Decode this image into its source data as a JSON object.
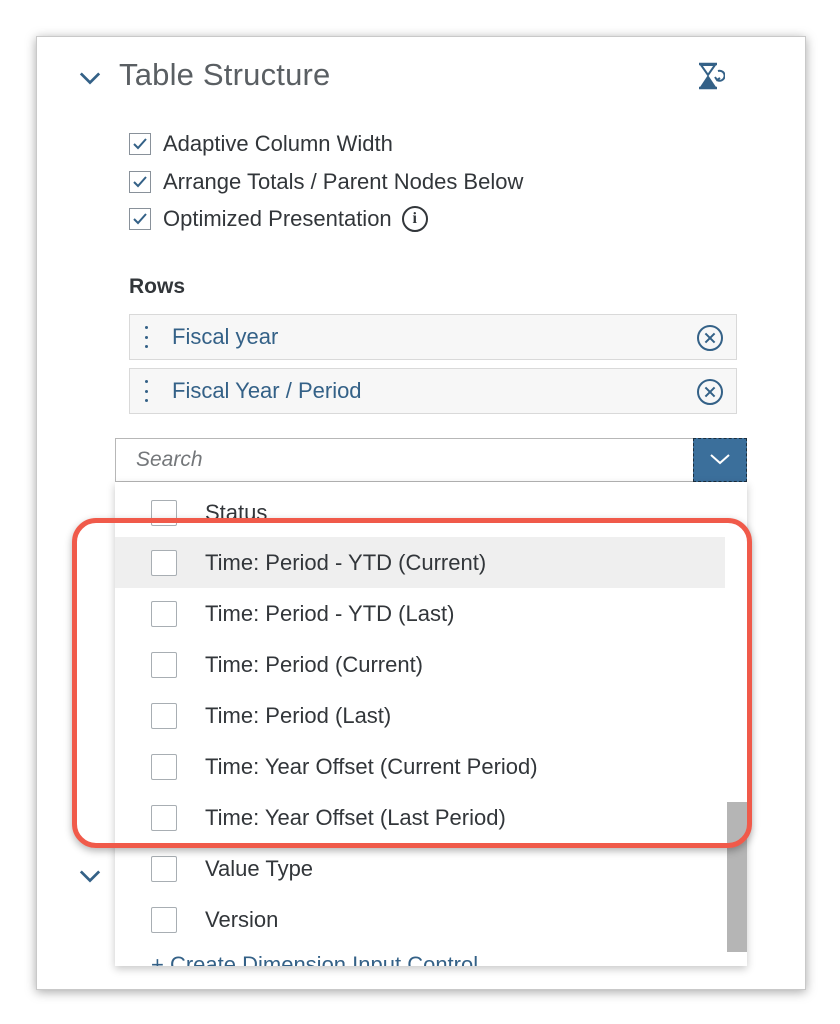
{
  "panel": {
    "section_title": "Table Structure",
    "colors": {
      "accent": "#346187",
      "button": "#3b6f9b",
      "highlight": "#f05a4a"
    }
  },
  "options": [
    {
      "label": "Adaptive Column Width",
      "checked": true
    },
    {
      "label": "Arrange Totals / Parent Nodes Below",
      "checked": true
    },
    {
      "label": "Optimized Presentation",
      "checked": true,
      "icon": "info-icon"
    }
  ],
  "rows": {
    "label": "Rows",
    "tokens": [
      {
        "label": "Fiscal year"
      },
      {
        "label": "Fiscal Year / Period"
      }
    ]
  },
  "search": {
    "placeholder": "Search"
  },
  "dropdown": {
    "items": [
      {
        "label": "Status",
        "checked": false
      },
      {
        "label": "Time: Period - YTD (Current)",
        "checked": false,
        "hovered": true
      },
      {
        "label": "Time: Period - YTD (Last)",
        "checked": false
      },
      {
        "label": "Time: Period (Current)",
        "checked": false
      },
      {
        "label": "Time: Period (Last)",
        "checked": false
      },
      {
        "label": "Time: Year Offset (Current Period)",
        "checked": false
      },
      {
        "label": "Time: Year Offset (Last Period)",
        "checked": false
      },
      {
        "label": "Value Type",
        "checked": false
      },
      {
        "label": "Version",
        "checked": false
      }
    ],
    "create_link": "+ Create Dimension Input Control"
  }
}
